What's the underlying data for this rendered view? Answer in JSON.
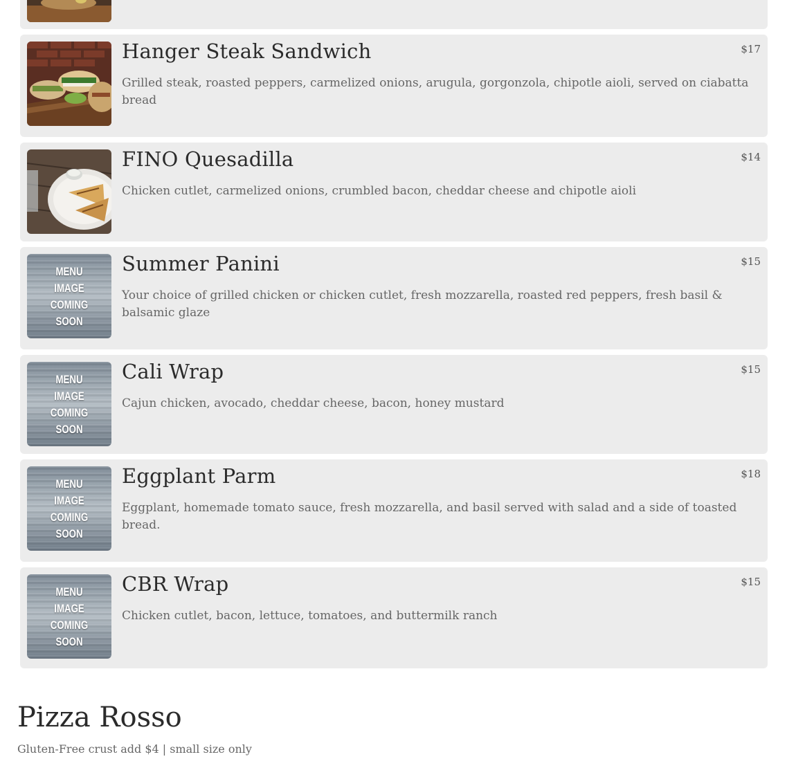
{
  "menu_items": [
    {
      "name": "Hanger Steak Sandwich",
      "price": "$17",
      "description": "Grilled steak, roasted peppers, carmelized onions, arugula, gorgonzola, chipotle aioli, served on ciabatta bread",
      "image": "sandwich-photo"
    },
    {
      "name": "FINO Quesadilla",
      "price": "$14",
      "description": "Chicken cutlet, carmelized onions, crumbled bacon, cheddar cheese and chipotle aioli",
      "image": "quesadilla-photo"
    },
    {
      "name": "Summer Panini",
      "price": "$15",
      "description": "Your choice of grilled chicken or chicken cutlet, fresh mozzarella, roasted red peppers, fresh basil & balsamic glaze",
      "image": "placeholder"
    },
    {
      "name": "Cali Wrap",
      "price": "$15",
      "description": "Cajun chicken, avocado, cheddar cheese, bacon, honey mustard",
      "image": "placeholder"
    },
    {
      "name": "Eggplant Parm",
      "price": "$18",
      "description": "Eggplant, homemade tomato sauce, fresh mozzarella, and basil served with salad and a side of toasted bread.",
      "image": "placeholder"
    },
    {
      "name": "CBR Wrap",
      "price": "$15",
      "description": "Chicken cutlet, bacon, lettuce, tomatoes, and buttermilk ranch",
      "image": "placeholder"
    }
  ],
  "placeholder_text": [
    "MENU",
    "IMAGE",
    "COMING",
    "SOON"
  ],
  "section": {
    "title": "Pizza Rosso",
    "subtitle": "Gluten-Free crust add $4 | small size only"
  },
  "colors": {
    "card_bg": "#ececec",
    "title_text": "#2b2b2b",
    "body_text": "#666666"
  }
}
